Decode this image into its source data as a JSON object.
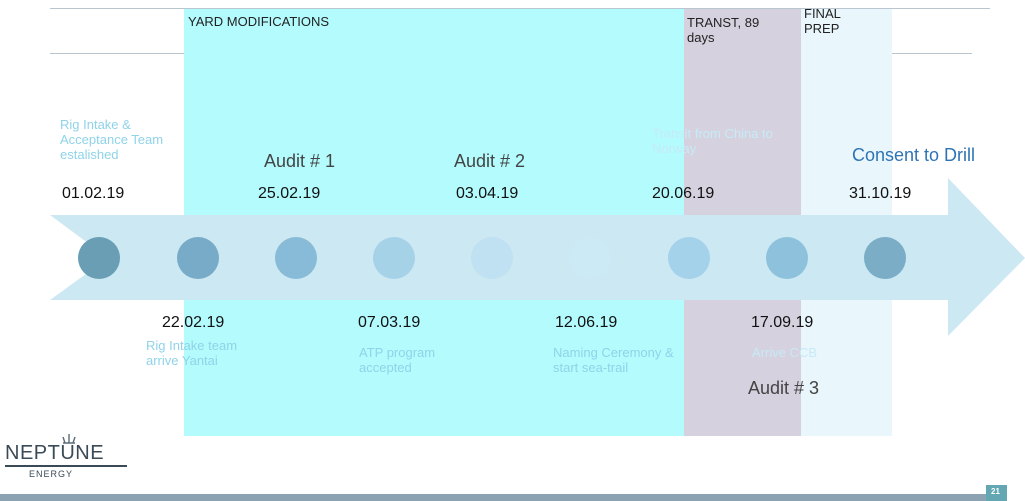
{
  "phases": {
    "yard": "YARD MODIFICATIONS",
    "transit": "TRANST, 89 days",
    "final": "FINAL PREP"
  },
  "top_events": [
    {
      "date": "01.02.19",
      "desc": "Rig Intake & Acceptance Team estalished"
    },
    {
      "date": "25.02.19",
      "label": "Audit # 1"
    },
    {
      "date": "03.04.19",
      "label": "Audit # 2"
    },
    {
      "date": "20.06.19",
      "desc": "Transit from China to Norway"
    },
    {
      "date": "31.10.19",
      "label": "Consent to Drill"
    }
  ],
  "bottom_events": [
    {
      "date": "22.02.19",
      "desc": "Rig Intake team arrive Yantai"
    },
    {
      "date": "07.03.19",
      "desc": "ATP program accepted"
    },
    {
      "date": "12.06.19",
      "desc": "Naming Ceremony & start sea-trail"
    },
    {
      "date": "17.09.19",
      "desc": "Arrive CCB",
      "label": "Audit # 3"
    }
  ],
  "logo": {
    "name": "NEPTUNE",
    "sub": "ENERGY"
  },
  "page_number": "21",
  "colors": {
    "yard_band": "#b3fbfd",
    "transit_band": "#d6d1df",
    "final_band": "#e9f6fc",
    "arrow": "#cce8f3",
    "accent_text": "#8fd3e9",
    "consent_text": "#2e74b5",
    "footer_bar": "#8aa2b1",
    "page_badge": "#62a7b1"
  }
}
